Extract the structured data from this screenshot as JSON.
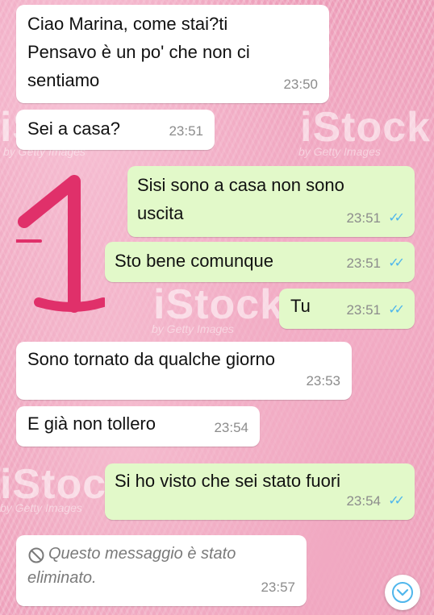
{
  "messages": [
    {
      "dir": "in",
      "text": "Ciao Marina, come stai?ti\nPensavo è un po' che non ci\nsentiamo",
      "time": "23:50"
    },
    {
      "dir": "in",
      "text": "Sei a casa?",
      "time": "23:51"
    },
    {
      "dir": "out",
      "text": "Sisi sono a casa non sono\nuscita",
      "time": "23:51",
      "status": "read"
    },
    {
      "dir": "out",
      "text": "Sto bene comunque",
      "time": "23:51",
      "status": "read"
    },
    {
      "dir": "out",
      "text": "Tu",
      "time": "23:51",
      "status": "read"
    },
    {
      "dir": "in",
      "text": "Sono tornato da qualche giorno",
      "time": "23:53"
    },
    {
      "dir": "in",
      "text": "E già non tollero",
      "time": "23:54"
    },
    {
      "dir": "out",
      "text": "Si ho visto che sei stato fuori",
      "time": "23:54",
      "status": "read"
    },
    {
      "dir": "in",
      "deleted": true,
      "text": "Questo messaggio è stato\neliminato.",
      "time": "23:57",
      "icon": "blocked-icon"
    }
  ],
  "watermarks": [
    {
      "logo": "iStock",
      "sub": "by Getty Images"
    },
    {
      "logo": "iStock",
      "sub": "by Getty Images"
    },
    {
      "logo": "iStock",
      "sub": "by Getty Images"
    },
    {
      "logo": "iStock",
      "sub": "by Getty Images"
    },
    {
      "logo": "iStock",
      "sub": "by Getty Images"
    }
  ],
  "annotation": {
    "text": "1",
    "color": "#e0306a"
  },
  "colors": {
    "incoming": "#ffffff",
    "outgoing": "#e2f9c9",
    "read_ticks": "#4fb6ec",
    "time": "#8c8c8c"
  },
  "scroll_button": {
    "icon": "chevron-down-icon"
  }
}
